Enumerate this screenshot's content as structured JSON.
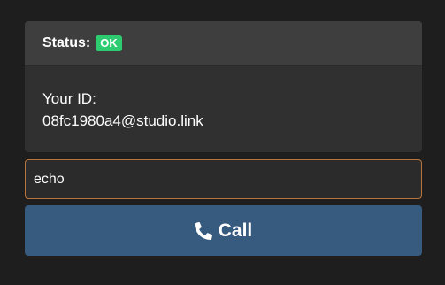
{
  "status": {
    "label": "Status:",
    "badge": "OK",
    "badge_color": "#2ecc71"
  },
  "identity": {
    "label": "Your ID:",
    "value": "08fc1980a4@studio.link"
  },
  "call_input": {
    "value": "echo",
    "placeholder": ""
  },
  "call_button": {
    "label": "Call",
    "icon": "phone-icon",
    "color": "#375a7f"
  },
  "colors": {
    "background": "#1e1e1e",
    "panel": "#303030",
    "panel_header": "#3e3e3e",
    "input_border_focus": "#b8743b"
  }
}
